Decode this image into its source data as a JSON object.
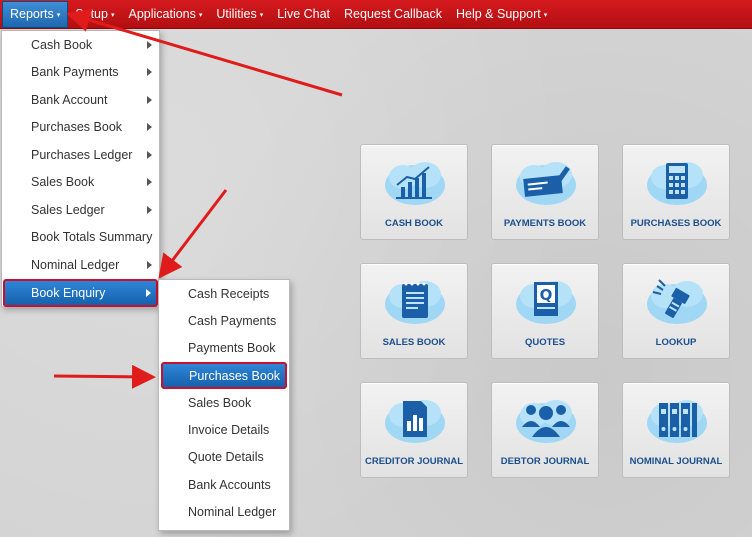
{
  "nav": {
    "items": [
      {
        "label": "Reports",
        "caret": "▾"
      },
      {
        "label": "Setup",
        "caret": "▾"
      },
      {
        "label": "Applications",
        "caret": "▾"
      },
      {
        "label": "Utilities",
        "caret": "▾"
      },
      {
        "label": "Live Chat",
        "caret": ""
      },
      {
        "label": "Request Callback",
        "caret": ""
      },
      {
        "label": "Help & Support",
        "caret": "▾"
      }
    ]
  },
  "reports_menu": {
    "items": [
      {
        "label": "Cash Book"
      },
      {
        "label": "Bank Payments"
      },
      {
        "label": "Bank Account"
      },
      {
        "label": "Purchases Book"
      },
      {
        "label": "Purchases Ledger"
      },
      {
        "label": "Sales Book"
      },
      {
        "label": "Sales Ledger"
      },
      {
        "label": "Book Totals Summary"
      },
      {
        "label": "Nominal Ledger"
      },
      {
        "label": "Book Enquiry"
      }
    ]
  },
  "book_enquiry_menu": {
    "items": [
      {
        "label": "Cash Receipts"
      },
      {
        "label": "Cash Payments"
      },
      {
        "label": "Payments Book"
      },
      {
        "label": "Purchases Book"
      },
      {
        "label": "Sales Book"
      },
      {
        "label": "Invoice Details"
      },
      {
        "label": "Quote Details"
      },
      {
        "label": "Bank Accounts"
      },
      {
        "label": "Nominal Ledger"
      }
    ]
  },
  "tiles": [
    {
      "label": "CASH BOOK",
      "icon": "bar-chart-icon"
    },
    {
      "label": "PAYMENTS BOOK",
      "icon": "cheque-pen-icon"
    },
    {
      "label": "PURCHASES BOOK",
      "icon": "calculator-icon"
    },
    {
      "label": "SALES BOOK",
      "icon": "notepad-icon"
    },
    {
      "label": "QUOTES",
      "icon": "quote-document-icon"
    },
    {
      "label": "LOOKUP",
      "icon": "flashlight-icon"
    },
    {
      "label": "CREDITOR JOURNAL",
      "icon": "chart-document-icon"
    },
    {
      "label": "DEBTOR JOURNAL",
      "icon": "people-group-icon"
    },
    {
      "label": "NOMINAL JOURNAL",
      "icon": "binders-icon"
    }
  ],
  "colors": {
    "nav_red": "#c8141a",
    "active_blue": "#1f6fc0",
    "tile_label": "#1b4f8c",
    "annotation_arrow": "#e01b1b",
    "cloud_blue": "#8fd0f2"
  }
}
